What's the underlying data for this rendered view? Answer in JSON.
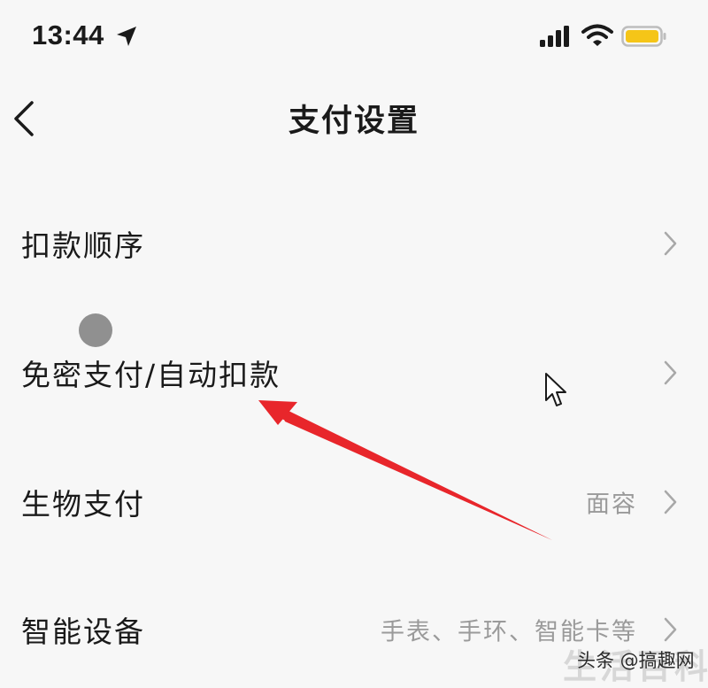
{
  "status_bar": {
    "time": "13:44",
    "icons": [
      "location-arrow-icon",
      "signal-icon",
      "wifi-icon",
      "battery-icon"
    ],
    "battery_color": "#f5c518"
  },
  "nav": {
    "back_icon": "chevron-left-icon",
    "title": "支付设置"
  },
  "settings": [
    {
      "label": "扣款顺序",
      "value": ""
    },
    {
      "label": "免密支付/自动扣款",
      "value": ""
    },
    {
      "label": "生物支付",
      "value": "面容"
    },
    {
      "label": "智能设备",
      "value": "手表、手环、智能卡等"
    }
  ],
  "annotation": {
    "arrow_color": "#e8262b",
    "cursor": "pointer-cursor-icon",
    "touch_indicator": "touch-dot"
  },
  "watermark": {
    "big": "生活百科",
    "text": "头条 @搞趣网"
  }
}
